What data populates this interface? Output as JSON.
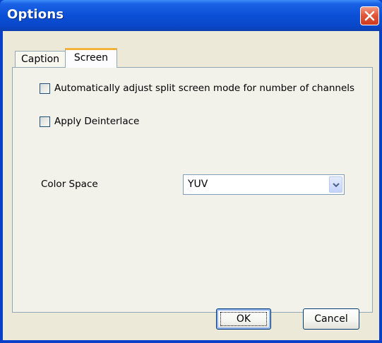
{
  "window": {
    "title": "Options"
  },
  "tabs": [
    {
      "label": "Caption",
      "selected": false
    },
    {
      "label": "Screen",
      "selected": true
    }
  ],
  "screen_tab": {
    "auto_adjust": {
      "label": "Automatically adjust split screen mode for number of channels",
      "checked": false
    },
    "deinterlace": {
      "label": "Apply Deinterlace",
      "checked": false
    },
    "color_space": {
      "label": "Color Space",
      "value": "YUV"
    }
  },
  "buttons": {
    "ok": "OK",
    "cancel": "Cancel"
  },
  "colors": {
    "titlebar": "#0b4fd6",
    "close_button": "#e3573b",
    "dialog_bg": "#ece9d8",
    "tab_highlight": "#f1b33c"
  },
  "icons": {
    "close": "close-icon",
    "dropdown": "chevron-down-icon"
  }
}
